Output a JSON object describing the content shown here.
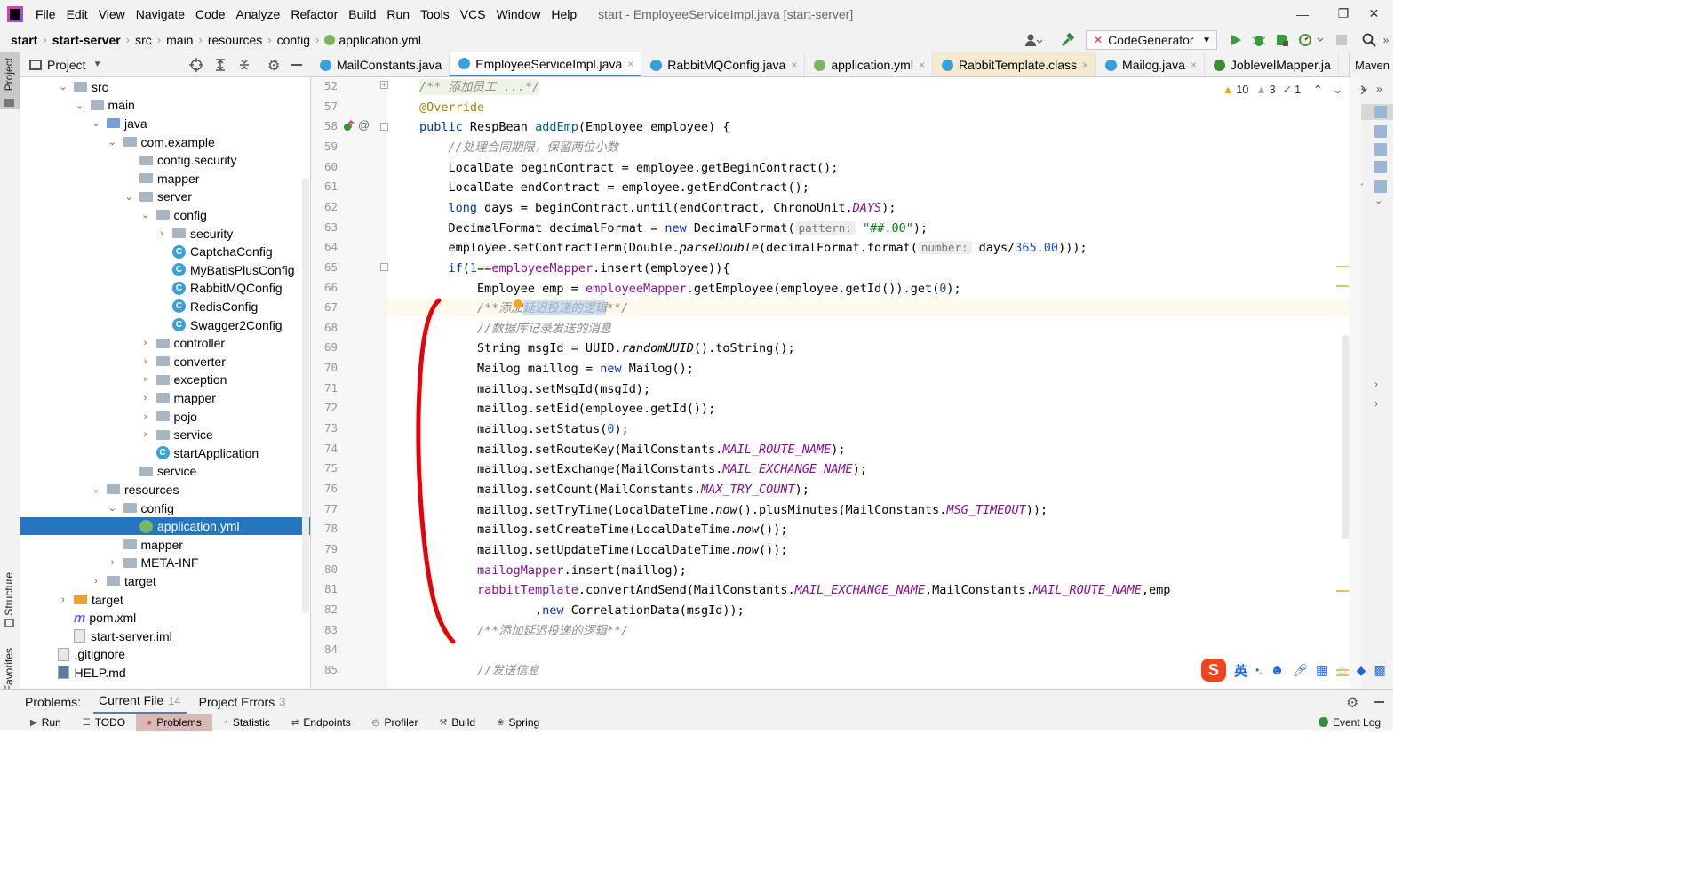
{
  "window": {
    "menu": [
      "File",
      "Edit",
      "View",
      "Navigate",
      "Code",
      "Analyze",
      "Refactor",
      "Build",
      "Run",
      "Tools",
      "VCS",
      "Window",
      "Help"
    ],
    "title": "start - EmployeeServiceImpl.java [start-server]",
    "minimize": "—",
    "maximize": "❐",
    "close": "✕"
  },
  "navbar": {
    "breadcrumbs": [
      "start",
      "start-server",
      "src",
      "main",
      "resources",
      "config",
      "application.yml"
    ],
    "run_config": "CodeGenerator"
  },
  "left_stripe": {
    "project": "Project",
    "structure": "Structure",
    "favorites": "Favorites"
  },
  "project_panel": {
    "title": "Project",
    "tree": [
      {
        "label": "src",
        "depth": 0,
        "icon": "folder",
        "chev": "v"
      },
      {
        "label": "main",
        "depth": 1,
        "icon": "folder",
        "chev": "v"
      },
      {
        "label": "java",
        "depth": 2,
        "icon": "folder-blue",
        "chev": "v"
      },
      {
        "label": "com.example",
        "depth": 3,
        "icon": "folder",
        "chev": "v"
      },
      {
        "label": "config.security",
        "depth": 4,
        "icon": "folder",
        "chev": ""
      },
      {
        "label": "mapper",
        "depth": 4,
        "icon": "folder",
        "chev": ""
      },
      {
        "label": "server",
        "depth": 4,
        "icon": "folder",
        "chev": "v"
      },
      {
        "label": "config",
        "depth": 5,
        "icon": "folder",
        "chev": "v"
      },
      {
        "label": "security",
        "depth": 6,
        "icon": "folder",
        "chev": ">"
      },
      {
        "label": "CaptchaConfig",
        "depth": 6,
        "icon": "class",
        "chev": ""
      },
      {
        "label": "MyBatisPlusConfig",
        "depth": 6,
        "icon": "class",
        "chev": ""
      },
      {
        "label": "RabbitMQConfig",
        "depth": 6,
        "icon": "class",
        "chev": ""
      },
      {
        "label": "RedisConfig",
        "depth": 6,
        "icon": "class",
        "chev": ""
      },
      {
        "label": "Swagger2Config",
        "depth": 6,
        "icon": "class",
        "chev": ""
      },
      {
        "label": "controller",
        "depth": 5,
        "icon": "folder",
        "chev": ">"
      },
      {
        "label": "converter",
        "depth": 5,
        "icon": "folder",
        "chev": ">"
      },
      {
        "label": "exception",
        "depth": 5,
        "icon": "folder",
        "chev": ">"
      },
      {
        "label": "mapper",
        "depth": 5,
        "icon": "folder",
        "chev": ">"
      },
      {
        "label": "pojo",
        "depth": 5,
        "icon": "folder",
        "chev": ">"
      },
      {
        "label": "service",
        "depth": 5,
        "icon": "folder",
        "chev": ">"
      },
      {
        "label": "startApplication",
        "depth": 5,
        "icon": "class",
        "chev": ""
      },
      {
        "label": "service",
        "depth": 4,
        "icon": "folder",
        "chev": ""
      },
      {
        "label": "resources",
        "depth": 2,
        "icon": "folder",
        "chev": "v"
      },
      {
        "label": "config",
        "depth": 3,
        "icon": "folder",
        "chev": "v"
      },
      {
        "label": "application.yml",
        "depth": 4,
        "icon": "yml",
        "chev": "",
        "selected": true
      },
      {
        "label": "mapper",
        "depth": 3,
        "icon": "folder",
        "chev": ""
      },
      {
        "label": "META-INF",
        "depth": 3,
        "icon": "folder",
        "chev": ">"
      },
      {
        "label": "target",
        "depth": 2,
        "icon": "folder",
        "chev": ">"
      },
      {
        "label": "target",
        "depth": 0,
        "icon": "folder-orange",
        "chev": ">"
      },
      {
        "label": "pom.xml",
        "depth": 0,
        "icon": "maven",
        "chev": ""
      },
      {
        "label": "start-server.iml",
        "depth": 0,
        "icon": "file",
        "chev": ""
      },
      {
        "label": ".gitignore",
        "depth": -1,
        "icon": "file",
        "chev": ""
      },
      {
        "label": "HELP.md",
        "depth": -1,
        "icon": "md",
        "chev": ""
      }
    ]
  },
  "tabs": [
    {
      "label": "MailConstants.java",
      "active": false,
      "closable": false
    },
    {
      "label": "EmployeeServiceImpl.java",
      "active": true,
      "closable": true
    },
    {
      "label": "RabbitMQConfig.java",
      "active": false,
      "closable": true
    },
    {
      "label": "application.yml",
      "active": false,
      "closable": true
    },
    {
      "label": "RabbitTemplate.class",
      "active": false,
      "closable": true,
      "tint": true
    },
    {
      "label": "Mailog.java",
      "active": false,
      "closable": true
    },
    {
      "label": "JoblevelMapper.ja",
      "active": false,
      "closable": false
    }
  ],
  "maven_label": "Maven",
  "inspections": {
    "warnings": "10",
    "weak": "3",
    "typos": "1"
  },
  "gutter": {
    "line_numbers": [
      "52",
      "57",
      "58",
      "59",
      "60",
      "61",
      "62",
      "63",
      "64",
      "65",
      "66",
      "67",
      "68",
      "69",
      "70",
      "71",
      "72",
      "73",
      "74",
      "75",
      "76",
      "77",
      "78",
      "79",
      "80",
      "81",
      "82",
      "83",
      "84",
      "85"
    ]
  },
  "problems_bar": {
    "label": "Problems:",
    "current_file": "Current File",
    "current_count": "14",
    "project_errors": "Project Errors",
    "project_count": "3"
  },
  "bottom_tools": [
    "Run",
    "TODO",
    "Problems",
    "Statistic",
    "Endpoints",
    "Profiler",
    "Build",
    "Spring"
  ],
  "event_log": "Event Log",
  "ime": {
    "lang": "英",
    "punct": "•,"
  },
  "colors": {
    "accent": "#2675bf",
    "selection": "#2675bf",
    "annotation_stroke": "#e8000b",
    "keyword": "#0033b3",
    "comment": "#8c8c8c",
    "field": "#871094"
  },
  "code_lines": [
    [
      {
        "c": "",
        "t": ""
      },
      {
        "c": "cm",
        "t": "/** 添加员工 ...*/"
      }
    ],
    [
      {
        "c": "an",
        "t": "@Override"
      }
    ],
    [
      {
        "c": "kw",
        "t": "public "
      },
      {
        "c": "",
        "t": "RespBean "
      },
      {
        "c": "mt",
        "t": "addEmp"
      },
      {
        "c": "",
        "t": "(Employee employee) {"
      }
    ],
    [
      {
        "c": "",
        "t": "    "
      },
      {
        "c": "cm",
        "t": "//处理合同期限，保留两位小数"
      }
    ],
    [
      {
        "c": "",
        "t": "    LocalDate beginContract = employee.getBeginContract();"
      }
    ],
    [
      {
        "c": "",
        "t": "    LocalDate endContract = employee.getEndContract();"
      }
    ],
    [
      {
        "c": "kw",
        "t": "    long "
      },
      {
        "c": "",
        "t": "days = beginContract.until(endContract, ChronoUnit."
      },
      {
        "c": "fi",
        "t": "DAYS"
      },
      {
        "c": "",
        "t": ");"
      }
    ],
    [
      {
        "c": "",
        "t": "    DecimalFormat decimalFormat = "
      },
      {
        "c": "kw",
        "t": "new "
      },
      {
        "c": "",
        "t": "DecimalFormat("
      },
      {
        "c": "hint",
        "t": "pattern:"
      },
      {
        "c": "st",
        "t": " \"##.00\""
      },
      {
        "c": "",
        "t": ");"
      }
    ],
    [
      {
        "c": "",
        "t": "    employee.setContractTerm(Double."
      },
      {
        "c": "it",
        "t": "parseDouble"
      },
      {
        "c": "",
        "t": "(decimalFormat.format("
      },
      {
        "c": "hint",
        "t": "number:"
      },
      {
        "c": "",
        "t": " days/"
      },
      {
        "c": "nu",
        "t": "365.00"
      },
      {
        "c": "",
        "t": ")));"
      }
    ],
    [
      {
        "c": "kw",
        "t": "    if"
      },
      {
        "c": "",
        "t": "("
      },
      {
        "c": "nu",
        "t": "1"
      },
      {
        "c": "",
        "t": "=="
      },
      {
        "c": "fd",
        "t": "employeeMapper"
      },
      {
        "c": "",
        "t": ".insert(employee)){"
      }
    ],
    [
      {
        "c": "",
        "t": "        Employee emp = "
      },
      {
        "c": "fd",
        "t": "employeeMapper"
      },
      {
        "c": "",
        "t": ".getEmployee(employee.getId()).get("
      },
      {
        "c": "nu",
        "t": "0"
      },
      {
        "c": "",
        "t": ");"
      }
    ],
    [
      {
        "c": "",
        "t": "        "
      },
      {
        "c": "cm",
        "t": "/**添加延迟投递的逻辑**/"
      }
    ],
    [
      {
        "c": "",
        "t": "        "
      },
      {
        "c": "cm",
        "t": "//数据库记录发送的消息"
      }
    ],
    [
      {
        "c": "",
        "t": "        String msgId = UUID."
      },
      {
        "c": "it",
        "t": "randomUUID"
      },
      {
        "c": "",
        "t": "().toString();"
      }
    ],
    [
      {
        "c": "",
        "t": "        Mailog maillog = "
      },
      {
        "c": "kw",
        "t": "new "
      },
      {
        "c": "",
        "t": "Mailog();"
      }
    ],
    [
      {
        "c": "",
        "t": "        maillog.setMsgId(msgId);"
      }
    ],
    [
      {
        "c": "",
        "t": "        maillog.setEid(employee.getId());"
      }
    ],
    [
      {
        "c": "",
        "t": "        maillog.setStatus("
      },
      {
        "c": "nu",
        "t": "0"
      },
      {
        "c": "",
        "t": ");"
      }
    ],
    [
      {
        "c": "",
        "t": "        maillog.setRouteKey(MailConstants."
      },
      {
        "c": "fi",
        "t": "MAIL_ROUTE_NAME"
      },
      {
        "c": "",
        "t": ");"
      }
    ],
    [
      {
        "c": "",
        "t": "        maillog.setExchange(MailConstants."
      },
      {
        "c": "fi",
        "t": "MAIL_EXCHANGE_NAME"
      },
      {
        "c": "",
        "t": ");"
      }
    ],
    [
      {
        "c": "",
        "t": "        maillog.setCount(MailConstants."
      },
      {
        "c": "fi",
        "t": "MAX_TRY_COUNT"
      },
      {
        "c": "",
        "t": ");"
      }
    ],
    [
      {
        "c": "",
        "t": "        maillog.setTryTime(LocalDateTime."
      },
      {
        "c": "it",
        "t": "now"
      },
      {
        "c": "",
        "t": "().plusMinutes(MailConstants."
      },
      {
        "c": "fi",
        "t": "MSG_TIMEOUT"
      },
      {
        "c": "",
        "t": "));"
      }
    ],
    [
      {
        "c": "",
        "t": "        maillog.setCreateTime(LocalDateTime."
      },
      {
        "c": "it",
        "t": "now"
      },
      {
        "c": "",
        "t": "());"
      }
    ],
    [
      {
        "c": "",
        "t": "        maillog.setUpdateTime(LocalDateTime."
      },
      {
        "c": "it",
        "t": "now"
      },
      {
        "c": "",
        "t": "());"
      }
    ],
    [
      {
        "c": "",
        "t": "        "
      },
      {
        "c": "fd",
        "t": "mailogMapper"
      },
      {
        "c": "",
        "t": ".insert(maillog);"
      }
    ],
    [
      {
        "c": "",
        "t": "        "
      },
      {
        "c": "fd",
        "t": "rabbitTemplate"
      },
      {
        "c": "",
        "t": ".convertAndSend(MailConstants."
      },
      {
        "c": "fi",
        "t": "MAIL_EXCHANGE_NAME"
      },
      {
        "c": "",
        "t": ",MailConstants."
      },
      {
        "c": "fi",
        "t": "MAIL_ROUTE_NAME"
      },
      {
        "c": "",
        "t": ",emp"
      }
    ],
    [
      {
        "c": "",
        "t": "                ,"
      },
      {
        "c": "kw",
        "t": "new "
      },
      {
        "c": "",
        "t": "CorrelationData(msgId));"
      }
    ],
    [
      {
        "c": "",
        "t": "        "
      },
      {
        "c": "cm",
        "t": "/**添加延迟投递的逻辑**/"
      }
    ],
    [
      {
        "c": "",
        "t": ""
      }
    ],
    [
      {
        "c": "",
        "t": "        "
      },
      {
        "c": "cm",
        "t": "//发送信息"
      }
    ]
  ]
}
